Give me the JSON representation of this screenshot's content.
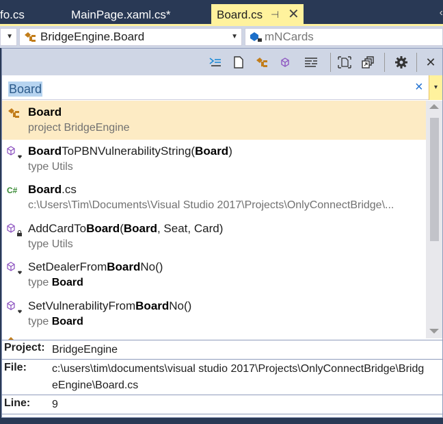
{
  "tabs": [
    {
      "label": "fo.cs",
      "active": false
    },
    {
      "label": "MainPage.xaml.cs*",
      "active": false
    },
    {
      "label": "Board.cs",
      "active": true
    }
  ],
  "tab_pin_icon": "pin-icon",
  "tab_close_icon": "close-icon",
  "tab_overflow": "‹",
  "navbar": {
    "project_combo": "",
    "type_combo": "BridgeEngine.Board",
    "member_combo": "mNCards"
  },
  "toolbar": {
    "icons": [
      "sync-with-document-icon",
      "files-icon",
      "types-icon",
      "members-icon",
      "text-search-icon",
      "preview-tab-icon",
      "promote-icon",
      "settings-icon",
      "close-icon"
    ]
  },
  "search": {
    "value": "Board",
    "clear_label": "×",
    "dropdown_label": "▾"
  },
  "results": [
    {
      "icon": "class-icon",
      "title": [
        {
          "t": "Board",
          "b": true
        }
      ],
      "sub": [
        {
          "t": "project BridgeEngine",
          "b": false
        }
      ],
      "selected": true
    },
    {
      "icon": "method-internal-icon",
      "title": [
        {
          "t": "Board",
          "b": true
        },
        {
          "t": "ToPBNVulnerabilityString(",
          "b": false
        },
        {
          "t": "Board",
          "b": true
        },
        {
          "t": ")",
          "b": false
        }
      ],
      "sub": [
        {
          "t": "type Utils",
          "b": false
        }
      ]
    },
    {
      "icon": "csharp-file-icon",
      "title": [
        {
          "t": "Board",
          "b": true
        },
        {
          "t": ".cs",
          "b": false
        }
      ],
      "sub": [
        {
          "t": "c:\\Users\\Tim\\Documents\\Visual Studio 2017\\Projects\\OnlyConnectBridge\\...",
          "b": false
        }
      ]
    },
    {
      "icon": "method-private-icon",
      "title": [
        {
          "t": "AddCardTo",
          "b": false
        },
        {
          "t": "Board",
          "b": true
        },
        {
          "t": "(",
          "b": false
        },
        {
          "t": "Board",
          "b": true
        },
        {
          "t": ", Seat, Card)",
          "b": false
        }
      ],
      "sub": [
        {
          "t": "type Utils",
          "b": false
        }
      ]
    },
    {
      "icon": "method-internal-icon",
      "title": [
        {
          "t": "SetDealerFrom",
          "b": false
        },
        {
          "t": "Board",
          "b": true
        },
        {
          "t": "No()",
          "b": false
        }
      ],
      "sub": [
        {
          "t": "type ",
          "b": false
        },
        {
          "t": "Board",
          "b": true
        }
      ]
    },
    {
      "icon": "method-internal-icon",
      "title": [
        {
          "t": "SetVulnerabilityFrom",
          "b": false
        },
        {
          "t": "Board",
          "b": true
        },
        {
          "t": "No()",
          "b": false
        }
      ],
      "sub": [
        {
          "t": "type ",
          "b": false
        },
        {
          "t": "Board",
          "b": true
        }
      ]
    }
  ],
  "details": {
    "project_label": "Project:",
    "project_value": "BridgeEngine",
    "file_label": "File:",
    "file_value": "c:\\users\\tim\\documents\\visual studio 2017\\Projects\\OnlyConnectBridge\\BridgeEngine\\Board.cs",
    "line_label": "Line:",
    "line_value": "9"
  },
  "colors": {
    "tab_active": "#fff29d",
    "selected_row": "#fdebc4",
    "class_icon": "#c27d1a",
    "method_icon": "#8a4fbf",
    "csharp_icon": "#388a34"
  }
}
